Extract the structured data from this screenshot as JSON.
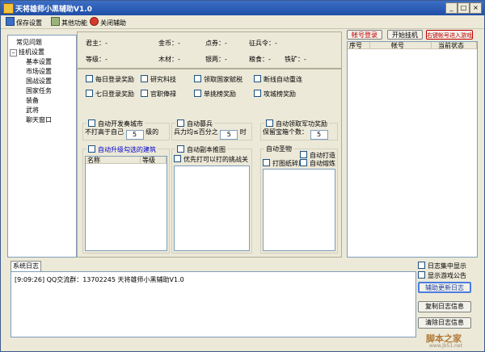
{
  "window": {
    "title": "天将雄师小黑辅助V1.0"
  },
  "toolbar": {
    "save": "保存设置",
    "other": "其他功能",
    "close": "关闭辅助"
  },
  "tree": {
    "items": [
      "常见问题",
      "挂机设置",
      "基本设置",
      "市场设置",
      "国战设置",
      "国家任务",
      "装备",
      "武将",
      "聊天窗口"
    ]
  },
  "info": {
    "row1": [
      "君主：-",
      "金币：-",
      "点券：-",
      "征兵令：-"
    ],
    "row2": [
      "等级：-",
      "木材：-",
      "银两：-",
      "粮食：-",
      "铁矿：-"
    ]
  },
  "options": {
    "row1": [
      "每日登录奖励",
      "研究科技",
      "领取国家赋税",
      "断线自动重连"
    ],
    "row2": [
      "七日登录奖励",
      "官职俸禄",
      "单挑榜奖励",
      "攻城榜奖励"
    ]
  },
  "groups": {
    "open_city": {
      "title": "自动开发奏城市",
      "prefix": "不打高于自己",
      "value": "5",
      "suffix": "级的"
    },
    "conscript": {
      "title": "自动募兵",
      "prefix": "兵力均≤百分之",
      "value": "5",
      "suffix": "时"
    },
    "merit": {
      "title": "自动领取军功奖励",
      "prefix": "保留宝箱个数：",
      "value": "5"
    },
    "upgrade": {
      "title": "自动升级勾选的建筑",
      "col_name": "名称",
      "col_level": "等级"
    },
    "dungeon": {
      "title": "自动副本推图",
      "option": "优先打可以打的挑战关"
    },
    "loot": {
      "title": "自动圣物",
      "auto_fight": "自动打造",
      "drawing": "打图纸碎片",
      "auto_smelt": "自动熔炼"
    }
  },
  "accounts": {
    "login_btn": "帐号登录",
    "start_btn": "开始挂机",
    "right_btn": "右键帐号进入游戏",
    "cols": [
      "序号",
      "帐号",
      "当前状态"
    ]
  },
  "log": {
    "tab": "系统日志",
    "entry": "[9:09:26] QQ交流群：13702245 天将雄师小黑辅助V1.0",
    "check_center": "日志集中显示",
    "check_notice": "显示游戏公告",
    "btn_update": "辅助更新日志",
    "btn_copy": "复制日志信息",
    "btn_clear": "清除日志信息"
  },
  "watermark": {
    "cn": "脚本之家",
    "url": "www.jb51.net"
  }
}
